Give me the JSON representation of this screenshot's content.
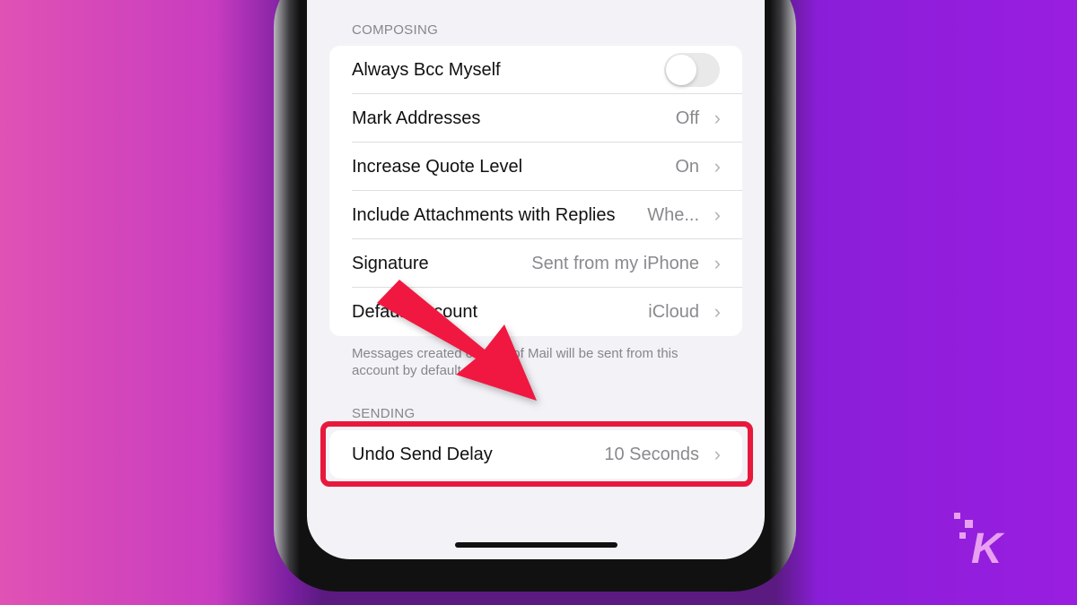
{
  "composing": {
    "header": "COMPOSING",
    "rows": [
      {
        "label": "Always Bcc Myself",
        "type": "toggle",
        "on": false
      },
      {
        "label": "Mark Addresses",
        "value": "Off"
      },
      {
        "label": "Increase Quote Level",
        "value": "On"
      },
      {
        "label": "Include Attachments with Replies",
        "value": "Whe..."
      },
      {
        "label": "Signature",
        "value": "Sent from my iPhone"
      },
      {
        "label": "Default Account",
        "value": "iCloud"
      }
    ],
    "footer": "Messages created outside of Mail will be sent from this account by default."
  },
  "sending": {
    "header": "SENDING",
    "rows": [
      {
        "label": "Undo Send Delay",
        "value": "10 Seconds"
      }
    ]
  },
  "annotation": {
    "highlight_color": "#e8183c",
    "arrow_color": "#f01840"
  },
  "watermark": {
    "letter": "K"
  }
}
